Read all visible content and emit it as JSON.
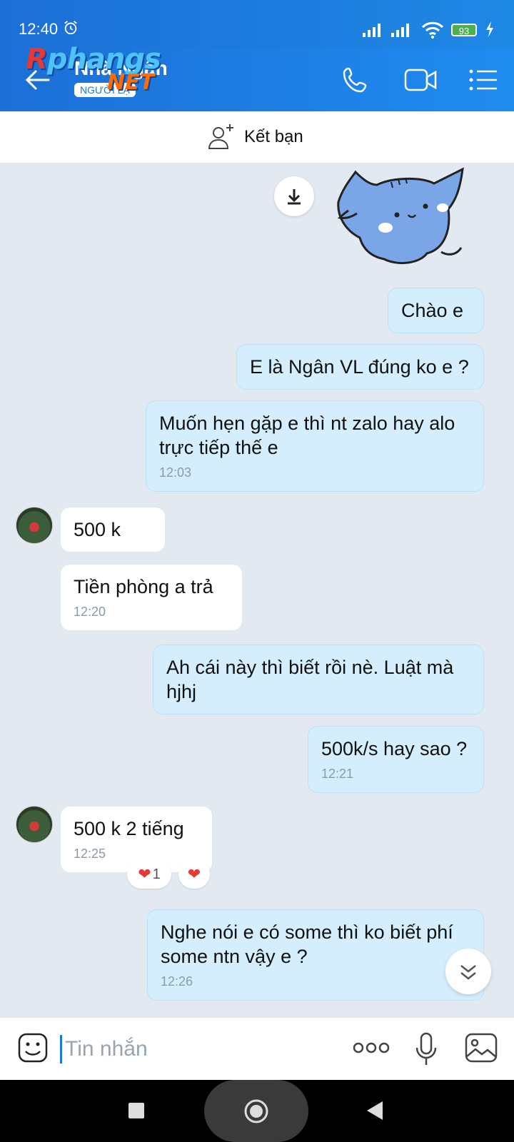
{
  "status": {
    "time": "12:40",
    "battery": "93"
  },
  "header": {
    "contact_name": "Nhà Ngân",
    "contact_sub": "NGƯỜI LẠ",
    "watermark_a": "R",
    "watermark_b": "phangs",
    "watermark_net": "NET"
  },
  "friend_bar": {
    "label": "Kết bạn"
  },
  "messages": [
    {
      "side": "out",
      "text": "Chào e",
      "time": ""
    },
    {
      "side": "out",
      "text": "E là Ngân VL đúng ko e ?",
      "time": ""
    },
    {
      "side": "out",
      "text": "Muốn hẹn gặp e thì nt zalo hay alo trực tiếp thế e",
      "time": "12:03"
    },
    {
      "side": "in",
      "text": "500 k",
      "time": ""
    },
    {
      "side": "in",
      "text": "Tiền phòng a trả",
      "time": "12:20"
    },
    {
      "side": "out",
      "text": "Ah cái này thì biết rồi nè. Luật mà hjhj",
      "time": ""
    },
    {
      "side": "out",
      "text": "500k/s hay sao ?",
      "time": "12:21"
    },
    {
      "side": "in",
      "text": "500 k 2 tiếng",
      "time": "12:25"
    },
    {
      "side": "out",
      "text": "Nghe nói e có some thì ko biết phí some ntn vậy e ?",
      "time": "12:26"
    }
  ],
  "reactions": {
    "count": "1"
  },
  "input": {
    "placeholder": "Tin nhắn"
  },
  "colors": {
    "accent": "#1e78e0",
    "outgoing_bubble": "#d5eefe",
    "chat_bg": "#e2e9f1"
  }
}
